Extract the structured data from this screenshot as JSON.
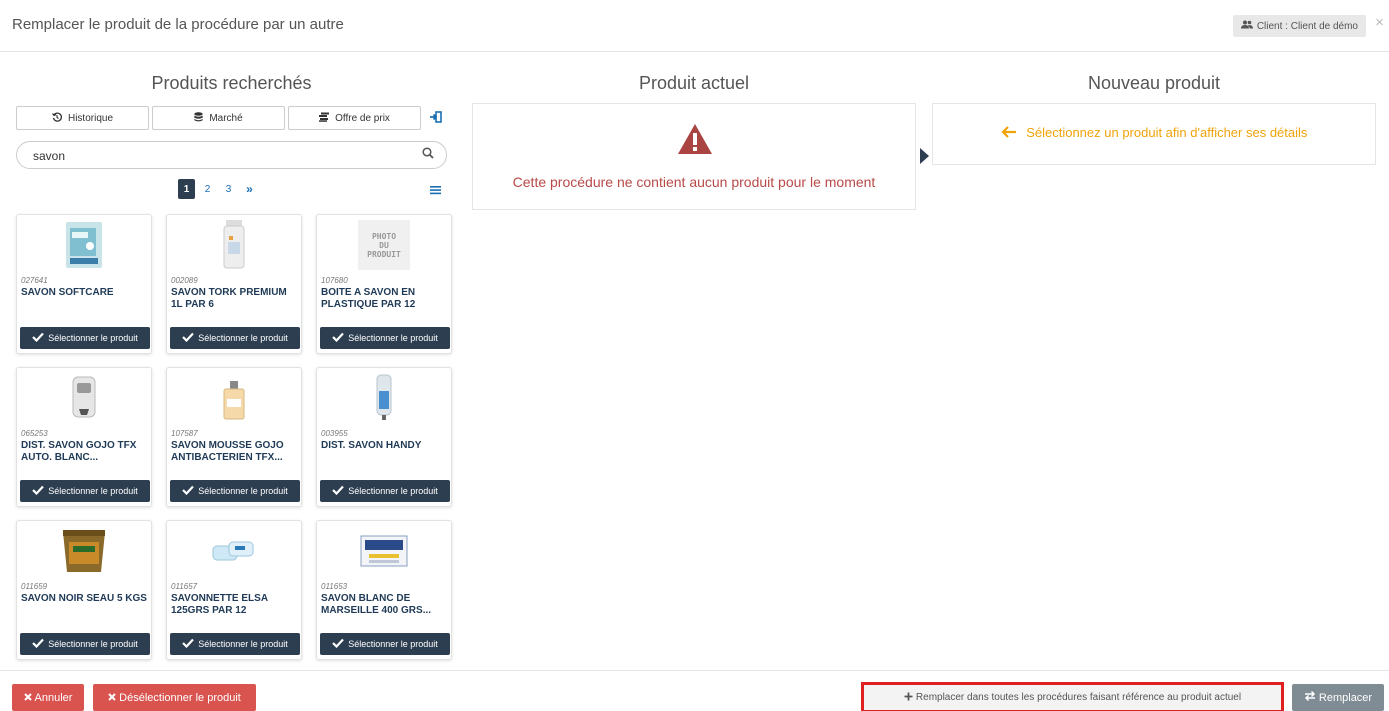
{
  "header": {
    "title": "Remplacer le produit de la procédure par un autre",
    "client_label": "Client : Client de démo",
    "close_glyph": "×"
  },
  "columns": {
    "left_title": "Produits recherchés",
    "middle_title": "Produit actuel",
    "right_title": "Nouveau produit"
  },
  "tabs": [
    {
      "label": "Historique",
      "icon": "history-icon"
    },
    {
      "label": "Marché",
      "icon": "database-icon"
    },
    {
      "label": "Offre de prix",
      "icon": "coins-icon"
    }
  ],
  "search": {
    "value": "savon",
    "placeholder": ""
  },
  "pagination": {
    "pages": [
      "1",
      "2",
      "3"
    ],
    "next": "»",
    "active": "1"
  },
  "products": [
    {
      "code": "027641",
      "name": "SAVON SOFTCARE",
      "image": "soap-pack"
    },
    {
      "code": "002089",
      "name": "SAVON TORK PREMIUM 1L PAR 6",
      "image": "bottle"
    },
    {
      "code": "107680",
      "name": "BOITE A SAVON EN PLASTIQUE PAR 12",
      "image": "placeholder"
    },
    {
      "code": "065253",
      "name": "DIST. SAVON GOJO TFX AUTO. BLANC...",
      "image": "dispenser"
    },
    {
      "code": "107587",
      "name": "SAVON MOUSSE GOJO ANTIBACTERIEN TFX...",
      "image": "refill"
    },
    {
      "code": "003955",
      "name": "DIST. SAVON HANDY",
      "image": "dispenser-blue"
    },
    {
      "code": "011659",
      "name": "SAVON NOIR SEAU 5 KGS",
      "image": "bucket"
    },
    {
      "code": "011657",
      "name": "SAVONNETTE ELSA 125GRS PAR 12",
      "image": "bars"
    },
    {
      "code": "011653",
      "name": "SAVON BLANC DE MARSEILLE 400 GRS...",
      "image": "box"
    }
  ],
  "select_label": "Sélectionner le produit",
  "photo_placeholder": [
    "PHOTO",
    "DU",
    "PRODUIT"
  ],
  "current_product": {
    "message": "Cette procédure ne contient aucun produit pour le moment"
  },
  "new_product": {
    "message": "Sélectionnez un produit afin d'afficher ses détails"
  },
  "footer": {
    "cancel": "Annuler",
    "deselect": "Désélectionner le produit",
    "replace_all": "Remplacer dans toutes les procédures faisant référence au produit actuel",
    "replace": "Remplacer"
  },
  "colors": {
    "danger": "#d9534f",
    "dark": "#2c3e50",
    "warning_text": "#f0a30a",
    "highlight_border": "#e02020"
  }
}
